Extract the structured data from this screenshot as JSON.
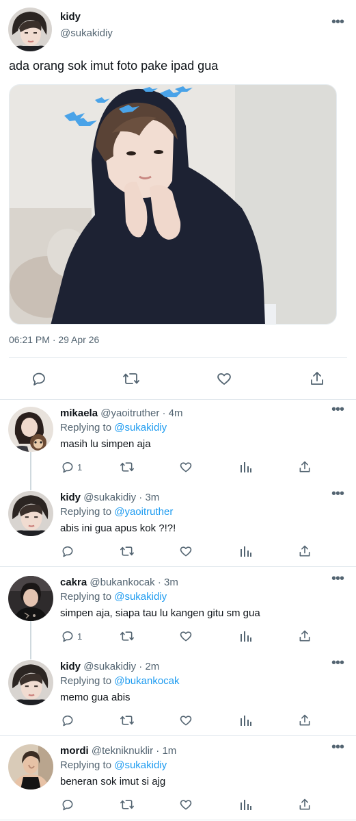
{
  "main_tweet": {
    "name": "kidy",
    "handle": "@sukakidiy",
    "text": "ada orang sok imut foto pake ipad gua",
    "timestamp": "06:21 PM · 29 Apr 26",
    "more": "•••"
  },
  "replies": [
    {
      "name": "mikaela",
      "handle": "@yaoitruther",
      "time": "· 4m",
      "replying_prefix": "Replying to ",
      "replying_to": "@sukakidiy",
      "text": "masih lu simpen aja",
      "reply_count": "1",
      "more": "•••"
    },
    {
      "name": "kidy",
      "handle": "@sukakidiy",
      "time": "· 3m",
      "replying_prefix": "Replying to ",
      "replying_to": "@yaoitruther",
      "text": "abis ini gua apus kok ?!?!",
      "reply_count": "",
      "more": "•••"
    },
    {
      "name": "cakra",
      "handle": "@bukankocak",
      "time": "· 3m",
      "replying_prefix": "Replying to ",
      "replying_to": "@sukakidiy",
      "text": "simpen aja, siapa tau lu kangen gitu sm gua",
      "reply_count": "1",
      "more": "•••"
    },
    {
      "name": "kidy",
      "handle": "@sukakidiy",
      "time": "· 2m",
      "replying_prefix": "Replying to ",
      "replying_to": "@bukankocak",
      "text": "memo gua abis",
      "reply_count": "",
      "more": "•••"
    },
    {
      "name": "mordi",
      "handle": "@tekniknuklir",
      "time": "· 1m",
      "replying_prefix": "Replying to ",
      "replying_to": "@sukakidiy",
      "text": "beneran sok imut si ajg",
      "reply_count": "",
      "more": "•••"
    }
  ],
  "icons": {
    "reply": "comment-icon",
    "retweet": "retweet-icon",
    "like": "heart-icon",
    "analytics": "analytics-icon",
    "share": "share-icon",
    "more": "more-icon"
  },
  "colors": {
    "link": "#1d9bf0",
    "muted": "#536471",
    "divider": "#e1e8ed"
  }
}
